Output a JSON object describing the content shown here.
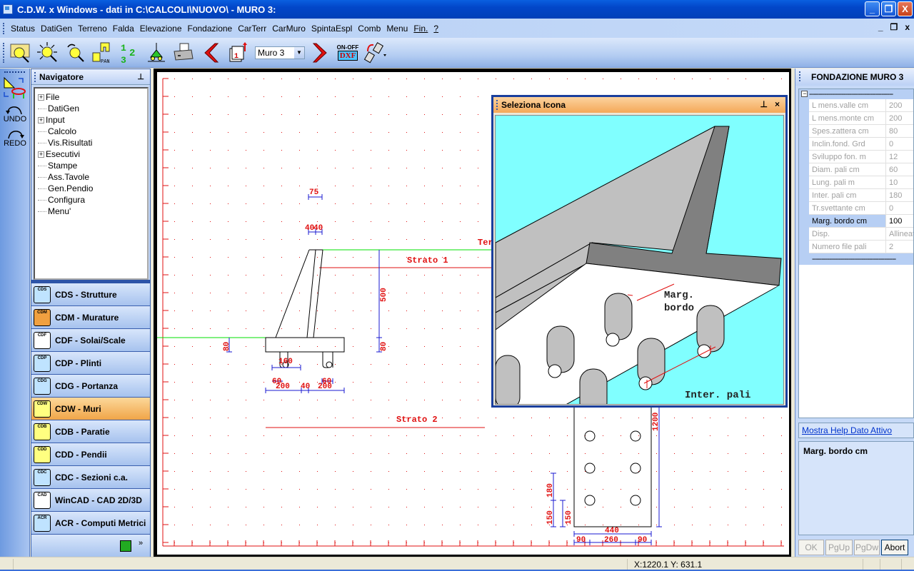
{
  "window": {
    "title": "C.D.W. x Windows - dati in C:\\CALCOLI\\NUOVO\\ - MURO 3:",
    "minimize": "_",
    "restore": "❐",
    "close": "X"
  },
  "menubar": {
    "items": [
      "Status",
      "DatiGen",
      "Terreno",
      "Falda",
      "Elevazione",
      "Fondazione",
      "CarTerr",
      "CarMuro",
      "SpintaEspl",
      "Comb",
      "Menu",
      "Fin.",
      "?"
    ],
    "mdi_minimize": "_",
    "mdi_restore": "❐",
    "mdi_close": "x"
  },
  "toolbar": {
    "buttons": [
      {
        "name": "zoom-window-icon"
      },
      {
        "name": "zoom-extents-icon"
      },
      {
        "name": "zoom-previous-icon"
      },
      {
        "name": "pan-icon",
        "label": "PAN"
      },
      {
        "name": "numbering-icon"
      },
      {
        "name": "supports-icon"
      },
      {
        "name": "print-icon"
      },
      {
        "name": "previous-icon"
      },
      {
        "name": "page-icon"
      }
    ],
    "selector_value": "Muro  3",
    "next": "next-icon",
    "dxf_label": "DXF",
    "dxf_toggle": "ON-OFF",
    "copy": "copy-icon"
  },
  "left_toolbar": {
    "undo": "UNDO",
    "redo": "REDO"
  },
  "navigator": {
    "title": "Navigatore",
    "tree": [
      {
        "label": "File",
        "expandable": true
      },
      {
        "label": "DatiGen",
        "expandable": false
      },
      {
        "label": "Input",
        "expandable": true
      },
      {
        "label": "Calcolo",
        "expandable": false
      },
      {
        "label": "Vis.Risultati",
        "expandable": false
      },
      {
        "label": "Esecutivi",
        "expandable": true
      },
      {
        "label": "Stampe",
        "expandable": false
      },
      {
        "label": "Ass.Tavole",
        "expandable": false
      },
      {
        "label": "Gen.Pendio",
        "expandable": false
      },
      {
        "label": "Configura",
        "expandable": false
      },
      {
        "label": "Menu'",
        "expandable": false
      }
    ],
    "modules": [
      {
        "code": "CDS",
        "label": "CDS - Strutture",
        "active": false
      },
      {
        "code": "CDM",
        "label": "CDM - Murature",
        "active": false
      },
      {
        "code": "CDF",
        "label": "CDF - Solai/Scale",
        "active": false
      },
      {
        "code": "CDP",
        "label": "CDP - Plinti",
        "active": false
      },
      {
        "code": "CDG",
        "label": "CDG - Portanza",
        "active": false
      },
      {
        "code": "CDW",
        "label": "CDW - Muri",
        "active": true
      },
      {
        "code": "CDB",
        "label": "CDB - Paratie",
        "active": false
      },
      {
        "code": "CDD",
        "label": "CDD - Pendii",
        "active": false
      },
      {
        "code": "CDC",
        "label": "CDC - Sezioni c.a.",
        "active": false
      },
      {
        "code": "CAD",
        "label": "WinCAD - CAD 2D/3D",
        "active": false
      },
      {
        "code": "ACR",
        "label": "ACR - Computi Metrici",
        "active": false
      }
    ],
    "more": "»"
  },
  "drawing": {
    "labels": {
      "strato1": "Strato 1",
      "strato2": "Strato 2",
      "terreno": "Ter"
    },
    "dimensions": {
      "top_width": "75",
      "stem_top_left": "40",
      "stem_top_right": "40",
      "wall_height": "500",
      "base_thickness_left": "80",
      "base_thickness_right": "80",
      "pile_spacing": "160",
      "pile_diam_left": "60",
      "pile_diam_right": "60",
      "toe_length": "200",
      "stem_width": "40",
      "heel_length": "200",
      "plan_length": "1200",
      "plan_width": "440",
      "plan_edge_left": "90",
      "plan_center": "260",
      "plan_edge_right": "90",
      "plan_pile_interval": "180",
      "plan_edge_margin_a": "150",
      "plan_edge_margin_b": "150"
    }
  },
  "popup": {
    "title": "Seleziona Icona",
    "pin": "⊥",
    "close": "×",
    "label_margin": "Marg.",
    "label_margin2": "bordo",
    "label_interval": "Inter. pali"
  },
  "properties": {
    "title": "FONDAZIONE MURO 3",
    "separator": "--------------------------------------------",
    "rows": [
      {
        "label": "L mens.valle   cm",
        "value": "200",
        "active": false
      },
      {
        "label": "L mens.monte   cm",
        "value": "200",
        "active": false
      },
      {
        "label": "Spes.zattera   cm",
        "value": "80",
        "active": false
      },
      {
        "label": "Inclin.fond.  Grd",
        "value": "0",
        "active": false
      },
      {
        "label": "Sviluppo fon.   m",
        "value": "12",
        "active": false
      },
      {
        "label": "Diam. pali     cm",
        "value": "60",
        "active": false
      },
      {
        "label": "Lung. pali      m",
        "value": "10",
        "active": false
      },
      {
        "label": "Inter. pali    cm",
        "value": "180",
        "active": false
      },
      {
        "label": "Tr.svettante   cm",
        "value": "0",
        "active": false
      },
      {
        "label": "Marg. bordo    cm",
        "value": "100",
        "active": true
      },
      {
        "label": "Disp.",
        "value": "Allineati",
        "active": false
      },
      {
        "label": "Numero file pali",
        "value": "2",
        "active": false
      }
    ],
    "help_link": "Mostra Help Dato Attivo",
    "help_text": "Marg. bordo    cm",
    "buttons": {
      "ok": "OK",
      "pgup": "PgUp",
      "pgdw": "PgDw",
      "abort": "Abort"
    }
  },
  "statusbar": {
    "coords": "X:1220.1  Y: 631.1"
  }
}
